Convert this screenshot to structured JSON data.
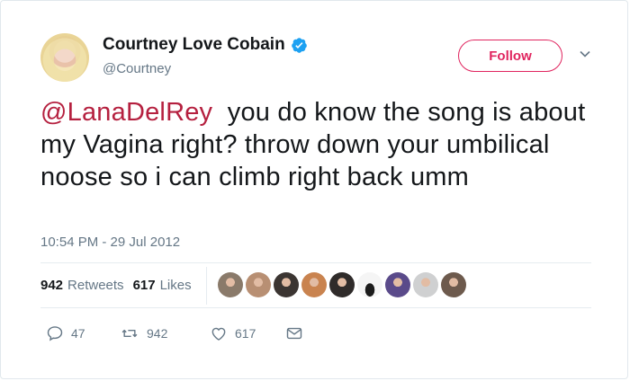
{
  "user": {
    "name": "Courtney Love Cobain",
    "handle": "@Courtney",
    "verified": true
  },
  "follow_label": "Follow",
  "tweet": {
    "mention": "@LanaDelRey",
    "text": "  you do know the song is about my Vagina right? throw down your umbilical noose so i can climb right back umm"
  },
  "timestamp": "10:54 PM - 29 Jul 2012",
  "stats": {
    "retweets_count": "942",
    "retweets_label": "Retweets",
    "likes_count": "617",
    "likes_label": "Likes"
  },
  "likers": [
    {
      "color": "#8a7a6a"
    },
    {
      "color": "#b88f73"
    },
    {
      "color": "#3b3532"
    },
    {
      "color": "#c9834f"
    },
    {
      "color": "#2f2b2a"
    },
    {
      "color": "#f5f5f5"
    },
    {
      "color": "#5a4a8a"
    },
    {
      "color": "#cfd0d1"
    },
    {
      "color": "#6d5a4d"
    }
  ],
  "actions": {
    "reply_count": "47",
    "retweet_count": "942",
    "like_count": "617"
  },
  "colors": {
    "accent": "#e0245e",
    "mention": "#b5203f",
    "muted": "#657786",
    "verified": "#1da1f2"
  }
}
